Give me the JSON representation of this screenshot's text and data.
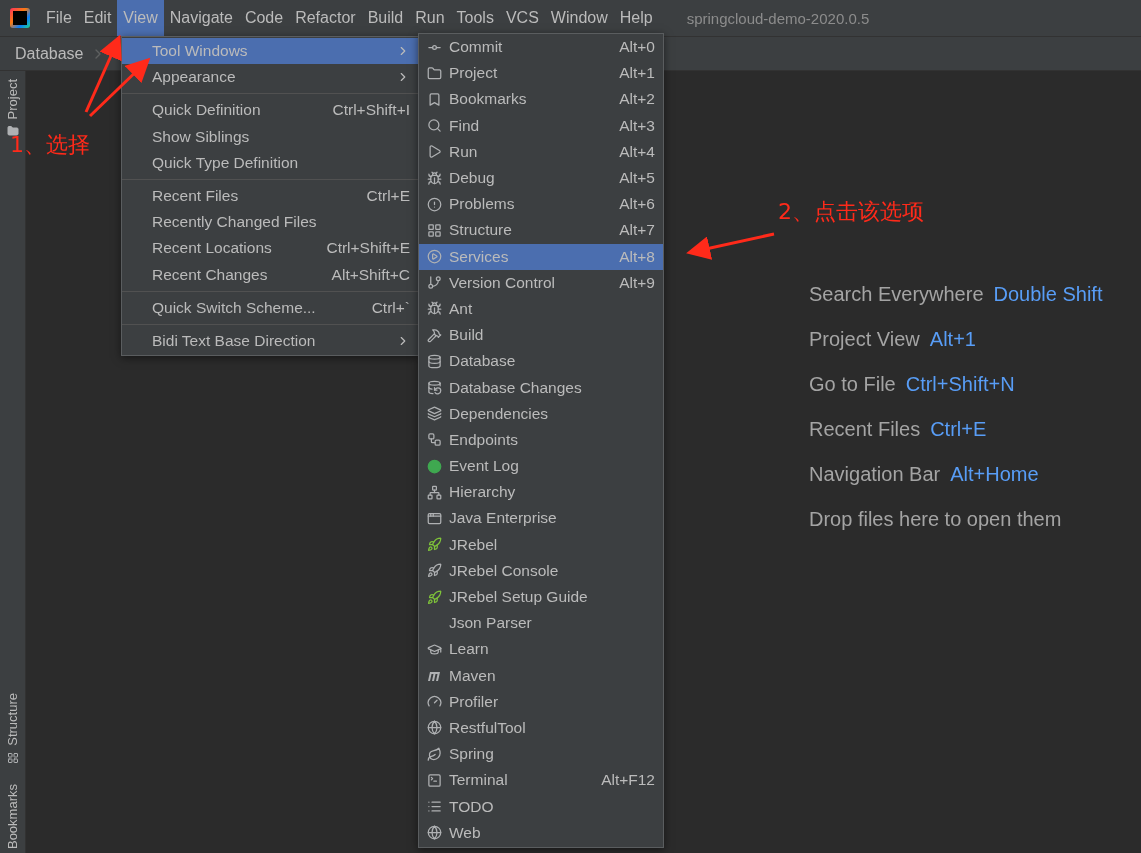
{
  "menu_bar": {
    "items": [
      {
        "label": "File",
        "selected": false
      },
      {
        "label": "Edit",
        "selected": false
      },
      {
        "label": "View",
        "selected": true
      },
      {
        "label": "Navigate",
        "selected": false
      },
      {
        "label": "Code",
        "selected": false
      },
      {
        "label": "Refactor",
        "selected": false
      },
      {
        "label": "Build",
        "selected": false
      },
      {
        "label": "Run",
        "selected": false
      },
      {
        "label": "Tools",
        "selected": false
      },
      {
        "label": "VCS",
        "selected": false
      },
      {
        "label": "Window",
        "selected": false
      },
      {
        "label": "Help",
        "selected": false
      }
    ],
    "title": "springcloud-demo-2020.0.5"
  },
  "breadcrumb": {
    "items": [
      "Database"
    ]
  },
  "left_strip": {
    "top": [
      "Project"
    ],
    "bottom": [
      "Structure",
      "Bookmarks"
    ]
  },
  "view_menu": {
    "groups": [
      [
        {
          "label": "Tool Windows",
          "submenu": true,
          "selected": true
        },
        {
          "label": "Appearance",
          "submenu": true,
          "selected": false
        }
      ],
      [
        {
          "label": "Quick Definition",
          "shortcut": "Ctrl+Shift+I",
          "submenu": false,
          "selected": false
        },
        {
          "label": "Show Siblings",
          "submenu": false,
          "selected": false
        },
        {
          "label": "Quick Type Definition",
          "submenu": false,
          "selected": false
        }
      ],
      [
        {
          "label": "Recent Files",
          "shortcut": "Ctrl+E",
          "submenu": false,
          "selected": false
        },
        {
          "label": "Recently Changed Files",
          "submenu": false,
          "selected": false
        },
        {
          "label": "Recent Locations",
          "shortcut": "Ctrl+Shift+E",
          "submenu": false,
          "selected": false
        },
        {
          "label": "Recent Changes",
          "shortcut": "Alt+Shift+C",
          "submenu": false,
          "selected": false
        }
      ],
      [
        {
          "label": "Quick Switch Scheme...",
          "shortcut": "Ctrl+`",
          "submenu": false,
          "selected": false
        }
      ],
      [
        {
          "label": "Bidi Text Base Direction",
          "submenu": true,
          "selected": false
        }
      ]
    ]
  },
  "tool_windows_menu": {
    "items": [
      {
        "label": "Commit",
        "shortcut": "Alt+0",
        "selected": false
      },
      {
        "label": "Project",
        "shortcut": "Alt+1",
        "selected": false
      },
      {
        "label": "Bookmarks",
        "shortcut": "Alt+2",
        "selected": false
      },
      {
        "label": "Find",
        "shortcut": "Alt+3",
        "selected": false
      },
      {
        "label": "Run",
        "shortcut": "Alt+4",
        "selected": false
      },
      {
        "label": "Debug",
        "shortcut": "Alt+5",
        "selected": false
      },
      {
        "label": "Problems",
        "shortcut": "Alt+6",
        "selected": false
      },
      {
        "label": "Structure",
        "shortcut": "Alt+7",
        "selected": false
      },
      {
        "label": "Services",
        "shortcut": "Alt+8",
        "selected": true
      },
      {
        "label": "Version Control",
        "shortcut": "Alt+9",
        "selected": false
      },
      {
        "label": "Ant",
        "selected": false
      },
      {
        "label": "Build",
        "selected": false
      },
      {
        "label": "Database",
        "selected": false
      },
      {
        "label": "Database Changes",
        "selected": false
      },
      {
        "label": "Dependencies",
        "selected": false
      },
      {
        "label": "Endpoints",
        "selected": false
      },
      {
        "label": "Event Log",
        "selected": false
      },
      {
        "label": "Hierarchy",
        "selected": false
      },
      {
        "label": "Java Enterprise",
        "selected": false
      },
      {
        "label": "JRebel",
        "selected": false
      },
      {
        "label": "JRebel Console",
        "selected": false
      },
      {
        "label": "JRebel Setup Guide",
        "selected": false
      },
      {
        "label": "Json Parser",
        "selected": false
      },
      {
        "label": "Learn",
        "selected": false
      },
      {
        "label": "Maven",
        "selected": false
      },
      {
        "label": "Profiler",
        "selected": false
      },
      {
        "label": "RestfulTool",
        "selected": false
      },
      {
        "label": "Spring",
        "selected": false
      },
      {
        "label": "Terminal",
        "shortcut": "Alt+F12",
        "selected": false
      },
      {
        "label": "TODO",
        "selected": false
      },
      {
        "label": "Web",
        "selected": false
      }
    ]
  },
  "welcome_hints": [
    {
      "label": "Search Everywhere",
      "shortcut": "Double Shift"
    },
    {
      "label": "Project View",
      "shortcut": "Alt+1"
    },
    {
      "label": "Go to File",
      "shortcut": "Ctrl+Shift+N"
    },
    {
      "label": "Recent Files",
      "shortcut": "Ctrl+E"
    },
    {
      "label": "Navigation Bar",
      "shortcut": "Alt+Home"
    },
    {
      "label": "Drop files here to open them"
    }
  ],
  "annotations": [
    "1、选择",
    "2、点击该选项"
  ]
}
